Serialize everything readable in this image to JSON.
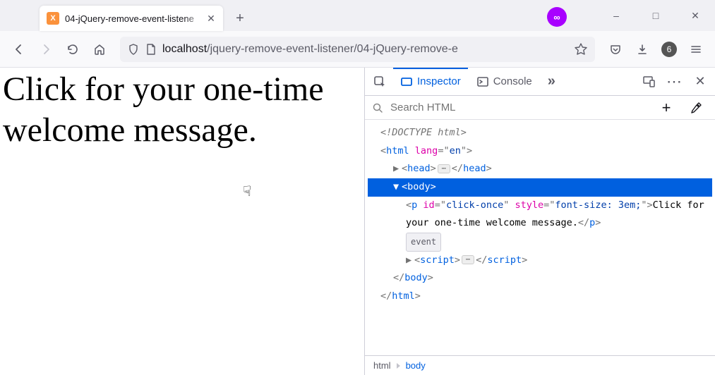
{
  "tab": {
    "title": "04-jQuery-remove-event-listene",
    "favicon_letter": "X"
  },
  "window": {
    "min": "–",
    "max": "□",
    "close": "✕"
  },
  "avatar_glyph": "∞",
  "url": {
    "host": "localhost",
    "path": "/jquery-remove-event-listener/04-jQuery-remove-e"
  },
  "toolbar": {
    "counter": "6"
  },
  "page_text": "Click for your one-time welcome message.",
  "devtools": {
    "tab_inspector": "Inspector",
    "tab_console": "Console",
    "overflow": "»",
    "search_placeholder": "Search HTML",
    "doctype": "<!DOCTYPE html>",
    "html_open_1": "html",
    "html_lang_attr": "lang",
    "html_lang_val": "en",
    "head": "head",
    "body": "body",
    "p_tag": "p",
    "p_id_attr": "id",
    "p_id_val": "click-once",
    "p_style_attr": "style",
    "p_style_val": "font-size: 3em;",
    "p_text": "Click for your one-time welcome message.",
    "event_badge": "event",
    "script": "script",
    "breadcrumb": {
      "html": "html",
      "body": "body"
    }
  }
}
